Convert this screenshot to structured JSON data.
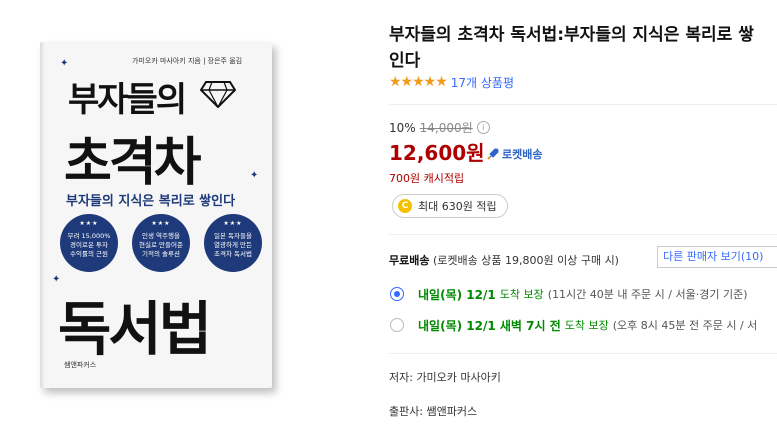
{
  "book_cover": {
    "author_line": "가미오카 마사아키 지음 | 장은주 옮김",
    "title_line1": "부자들의",
    "title_line2": "초격차",
    "subtitle": "부자들의 지식은 복리로 쌓인다",
    "pills": [
      {
        "stars": "★★★",
        "text": "무려 15,000%\n경이로운 투자\n수익률의 근원"
      },
      {
        "stars": "★★★",
        "text": "인생 역주행을\n현실로 만들어준\n기적의 솔루션"
      },
      {
        "stars": "★★★",
        "text": "일본 독자들을\n열광하게 만든\n초격차 독서법"
      }
    ],
    "title_line3": "독서법",
    "publisher_logo": "쌤앤파커스"
  },
  "product": {
    "title": "부자들의 초격차 독서법:부자들의 지식은 복리로 쌓인다",
    "rating_stars": "★★★★★",
    "rating_value": 5,
    "review_count": "17개 상품평",
    "discount_rate": "10%",
    "original_price": "14,000원",
    "sale_price": "12,600원",
    "rocket_label": "로켓배송",
    "cash_reward": "700원 캐시적립",
    "max_reward": "최대 630원 적립"
  },
  "shipping": {
    "label": "무료배송",
    "condition": "(로켓배송 상품 19,800원 이상 구매 시)",
    "other_sellers_button": "다른 판매자 보기(10)",
    "options": [
      {
        "date": "내일(목) 12/1",
        "tag": "도착 보장",
        "note": "(11시간 40분 내 주문 시 / 서울·경기 기준)",
        "selected": true
      },
      {
        "date": "내일(목) 12/1 새벽 7시 전",
        "tag": "도착 보장",
        "note": "(오후 8시 45분 전 주문 시 / 서",
        "selected": false
      }
    ]
  },
  "details": {
    "author": "저자: 가미오카 마사아키",
    "publisher": "출판사: 쌤앤파커스"
  },
  "colors": {
    "accent_blue": "#346aff",
    "price_red": "#ae0000",
    "delivery_green": "#008a00",
    "star_orange": "#f29a1a",
    "cover_navy": "#1f3a7a"
  },
  "icons": [
    "info-icon",
    "rocket-icon",
    "coin-icon",
    "star-icon",
    "diamond-icon"
  ]
}
